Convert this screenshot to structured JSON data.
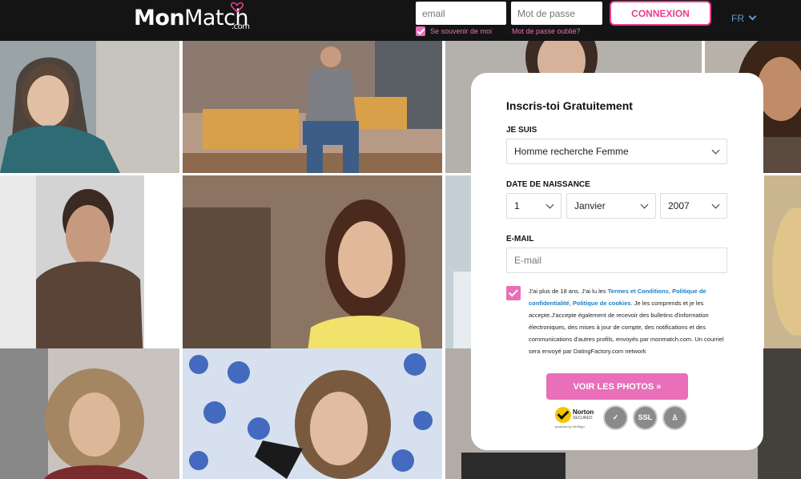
{
  "header": {
    "logo_bold": "Mon",
    "logo_light": "Match",
    "logo_suffix": ".com",
    "email_placeholder": "email",
    "password_placeholder": "Mot de passe",
    "login_button": "CONNEXION",
    "remember_me": "Se souvenir de moi",
    "forgot_password": "Mot de passe oublié?",
    "language": "FR"
  },
  "form": {
    "title": "Inscris-toi Gratuitement",
    "i_am_label": "JE SUIS",
    "i_am_value": "Homme recherche Femme",
    "birthdate_label": "DATE DE NAISSANCE",
    "day": "1",
    "month": "Janvier",
    "year": "2007",
    "email_label": "E-MAIL",
    "email_placeholder": "E-mail",
    "terms_1": "J'ai plus de 18 ans. J'ai lu les ",
    "terms_link_1": "Termes et Conditions",
    "terms_2": ", ",
    "terms_link_2": "Politique de confidentialité",
    "terms_3": ", ",
    "terms_link_3": "Politique de cookies",
    "terms_4": ". Je les comprends et je les accepte.J'accepte également de recevoir des bulletins d'information électroniques, des mises à jour de compte, des notifications et des communications d'autres profils, envoyés par monmatch.com. Un courriel sera envoyé par DatingFactory.com network",
    "submit": "VOIR LES PHOTOS »"
  },
  "badges": {
    "norton_title": "Norton",
    "norton_sub": "SECURED",
    "norton_powered": "powered by VeriSign",
    "ssl": "SSL"
  },
  "colors": {
    "accent": "#e86fb8",
    "link": "#1a7fc0",
    "topbar": "#141414"
  }
}
